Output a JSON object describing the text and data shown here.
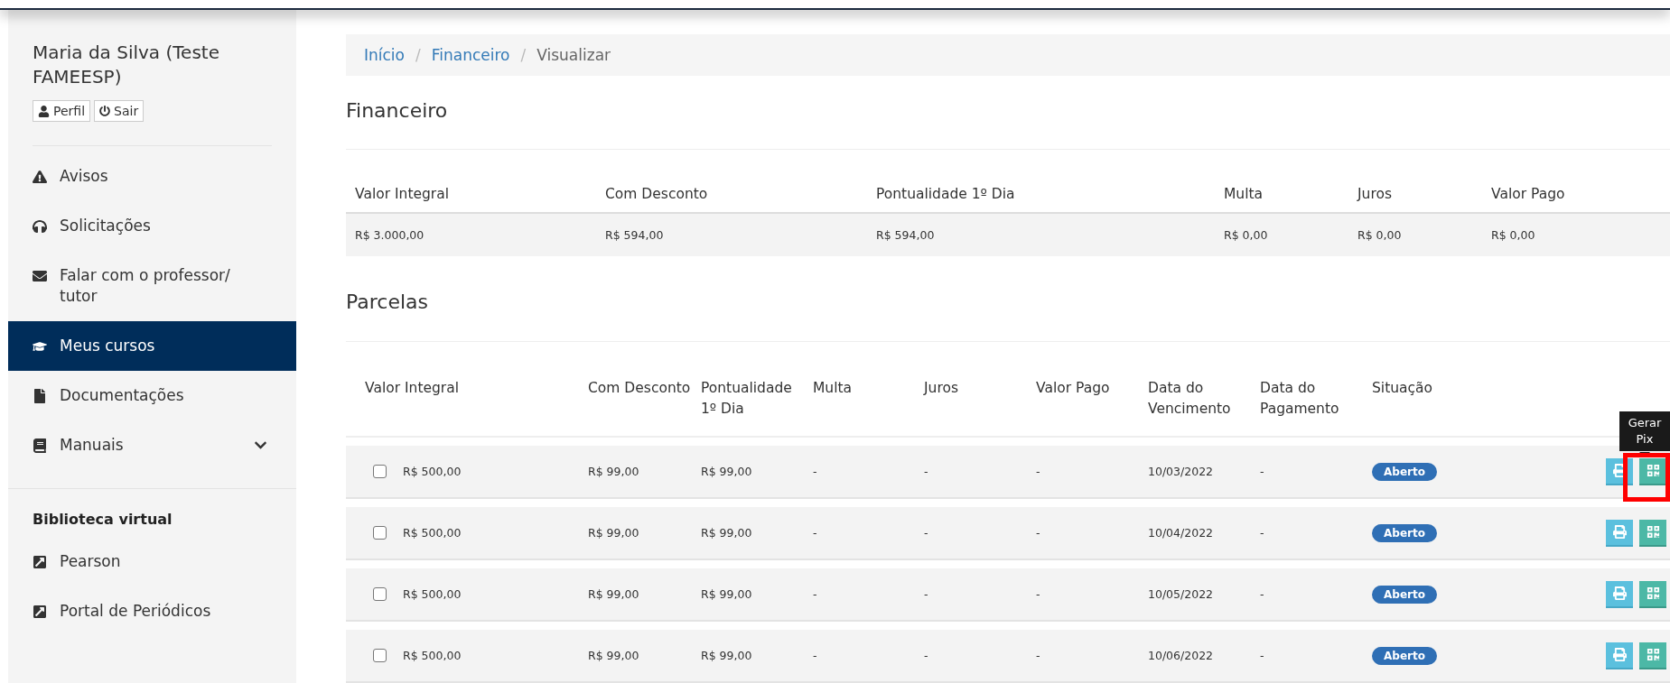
{
  "sidebar": {
    "user_name": "Maria da Silva (Teste FAMEESP)",
    "user_buttons": [
      {
        "label": "Perfil"
      },
      {
        "label": "Sair"
      }
    ],
    "menu": [
      {
        "label": "Avisos",
        "selected": false
      },
      {
        "label": "Solicitações",
        "selected": false
      },
      {
        "label": "Falar com o professor/ tutor",
        "selected": false
      },
      {
        "label": "Meus cursos",
        "selected": true
      },
      {
        "label": "Documentações",
        "selected": false
      },
      {
        "label": "Manuais",
        "selected": false,
        "expanded": false
      }
    ],
    "section_title": "Biblioteca virtual",
    "links": [
      {
        "label": "Pearson"
      },
      {
        "label": "Portal de Periódicos"
      }
    ]
  },
  "breadcrumb": {
    "separator": "/",
    "items": [
      {
        "label": "Início",
        "current": false
      },
      {
        "label": "Financeiro",
        "current": false
      },
      {
        "label": "Visualizar",
        "current": true
      }
    ]
  },
  "financeiro": {
    "title": "Financeiro",
    "columns": [
      "Valor Integral",
      "Com Desconto",
      "Pontualidade 1º Dia",
      "Multa",
      "Juros",
      "Valor Pago"
    ],
    "row": [
      "R$ 3.000,00",
      "R$ 594,00",
      "R$ 594,00",
      "R$ 0,00",
      "R$ 0,00",
      "R$ 0,00"
    ]
  },
  "parcelas": {
    "title": "Parcelas",
    "columns": [
      "Valor Integral",
      "Com Desconto",
      "Pontualidade 1º Dia",
      "Multa",
      "Juros",
      "Valor Pago",
      "Data do Vencimento",
      "Data do Pagamento",
      "Situação"
    ],
    "rows": [
      {
        "checked": false,
        "cells": [
          "R$ 500,00",
          "R$ 99,00",
          "R$ 99,00",
          "-",
          "-",
          "-",
          "10/03/2022",
          "-"
        ],
        "status": "Aberto",
        "tooltip": "Gerar Pix",
        "highlighted": true
      },
      {
        "checked": false,
        "cells": [
          "R$ 500,00",
          "R$ 99,00",
          "R$ 99,00",
          "-",
          "-",
          "-",
          "10/04/2022",
          "-"
        ],
        "status": "Aberto",
        "highlighted": false
      },
      {
        "checked": false,
        "cells": [
          "R$ 500,00",
          "R$ 99,00",
          "R$ 99,00",
          "-",
          "-",
          "-",
          "10/05/2022",
          "-"
        ],
        "status": "Aberto",
        "highlighted": false
      },
      {
        "checked": false,
        "cells": [
          "R$ 500,00",
          "R$ 99,00",
          "R$ 99,00",
          "-",
          "-",
          "-",
          "10/06/2022",
          "-"
        ],
        "status": "Aberto",
        "highlighted": false
      }
    ]
  }
}
